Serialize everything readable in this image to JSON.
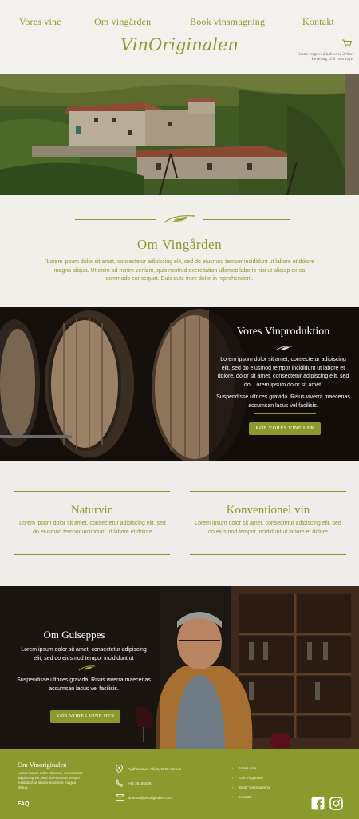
{
  "nav": {
    "items": [
      "Vores vine",
      "Om vingården",
      "Book vinsmagning",
      "Kontakt"
    ],
    "logo": "VinOriginalen",
    "shipping_line1": "Gratis fragt ved køb over 200kr",
    "shipping_line2": "Levering: 2-3 hverdage"
  },
  "about": {
    "title": "Om Vingården",
    "text": "\"Lorem ipsum dolor sit amet, consectetur adipiscing elit, sed do eiusmod tempor incididunt ut labore et dolore magna aliqua. Ut enim ad minim veniam, quis nostrud exercitation ullamco laboris nisi ut aliquip ex ea commodo consequat. Duis aute irure dolor in reprehenderit."
  },
  "production": {
    "title": "Vores Vinproduktion",
    "text1": "Lorem ipsum dolor sit amet, consectetur adipiscing elit, sed do eiusmod tempor incididunt ut labore et dolore. dolor sit amet, consectetur adipiscing elit, sed do. Lorem ipsum dolor sit amet.",
    "text2": "Suspendisse ultrices gravida. Risus viverra maecenas accumsan lacus vel facilisis.",
    "button": "KØB VORES VINE HER"
  },
  "types": {
    "left_title": "Naturvin",
    "left_text": "Lorem ipsum dolor sit amet, consectetur adipiscing elit, sed do eiusmod tempor incididunt ut labore et dolore",
    "right_title": "Konventionel vin",
    "right_text": "Lorem ipsum dolor sit amet, consectetur adipiscing elit, sed do eiusmod tempor incididunt ut labore et dolore"
  },
  "owner": {
    "title": "Om Guiseppes",
    "text1": "Lorem ipsum dolor sit amet, consectetur adipiscing elit, sed do eiusmod tempor incididunt ut",
    "text2": "Suspendisse ultrices gravida. Risus viverra maecenas accumsan lacus vel facilisis.",
    "button": "KØB VORES VINE HER"
  },
  "footer": {
    "title": "Om Vinoriginalen",
    "text": "Lorem ipsum dolor sit amet, consectetur adipiscing elit, sed do eiusmod tempor incididunt ut labore et dolore magna aliqua.",
    "faq": "FAQ",
    "address": "Rydhavnsvej Allé 3, 2900 Aarhus",
    "phone": "+45 28165536",
    "email": "write.us@vinoriginalen.com",
    "links": [
      "Vores vine",
      "Om Vingården",
      "Book Vinsmagning",
      "Kontakt"
    ]
  },
  "colors": {
    "accent": "#8a9a2c",
    "dark": "#1a140f",
    "paper": "#f1efea"
  }
}
